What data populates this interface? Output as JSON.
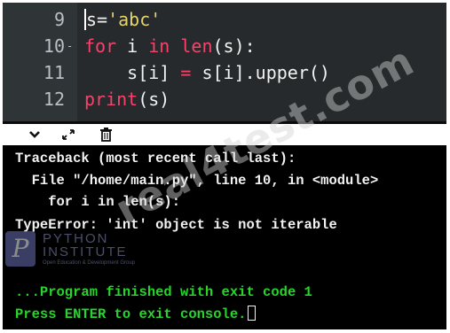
{
  "editor": {
    "lines": [
      {
        "number": "9",
        "fold": "",
        "parts": [
          {
            "t": "s",
            "c": "cursor-block"
          },
          {
            "t": "=",
            "c": ""
          },
          {
            "t": "'abc'",
            "c": "str"
          }
        ]
      },
      {
        "number": "10",
        "fold": "-",
        "parts": [
          {
            "t": "for",
            "c": "kw"
          },
          {
            "t": " i ",
            "c": ""
          },
          {
            "t": "in",
            "c": "kw"
          },
          {
            "t": " ",
            "c": ""
          },
          {
            "t": "len",
            "c": "bi"
          },
          {
            "t": "(s):",
            "c": ""
          }
        ]
      },
      {
        "number": "11",
        "fold": "",
        "parts": [
          {
            "t": "    s[i] ",
            "c": ""
          },
          {
            "t": "=",
            "c": "kw"
          },
          {
            "t": " s[i].upper()",
            "c": ""
          }
        ]
      },
      {
        "number": "12",
        "fold": "",
        "parts": [
          {
            "t": "print",
            "c": "bi"
          },
          {
            "t": "(s)",
            "c": ""
          }
        ]
      }
    ]
  },
  "toolbar": {
    "icons": [
      "chevron-down-icon",
      "expand-icon",
      "clear-console-icon"
    ]
  },
  "console": {
    "traceback_header": "Traceback (most recent call last):",
    "file_line": "  File \"/home/main.py\", line 10, in <module>",
    "code_line": "    for i in len(s):",
    "error_line": "TypeError: 'int' object is not iterable",
    "finished_line": "...Program finished with exit code 1",
    "press_enter_line": "Press ENTER to exit console."
  },
  "watermark": {
    "text": "real4test.com",
    "logo_line1": "PYTHON",
    "logo_line2": "INSTITUTE",
    "logo_tagline": "Open Education & Development Group"
  },
  "colors": {
    "keyword": "#f8426b",
    "string": "#e5d46e",
    "console_green": "#27d42b",
    "editor_bg": "#262a2c"
  }
}
